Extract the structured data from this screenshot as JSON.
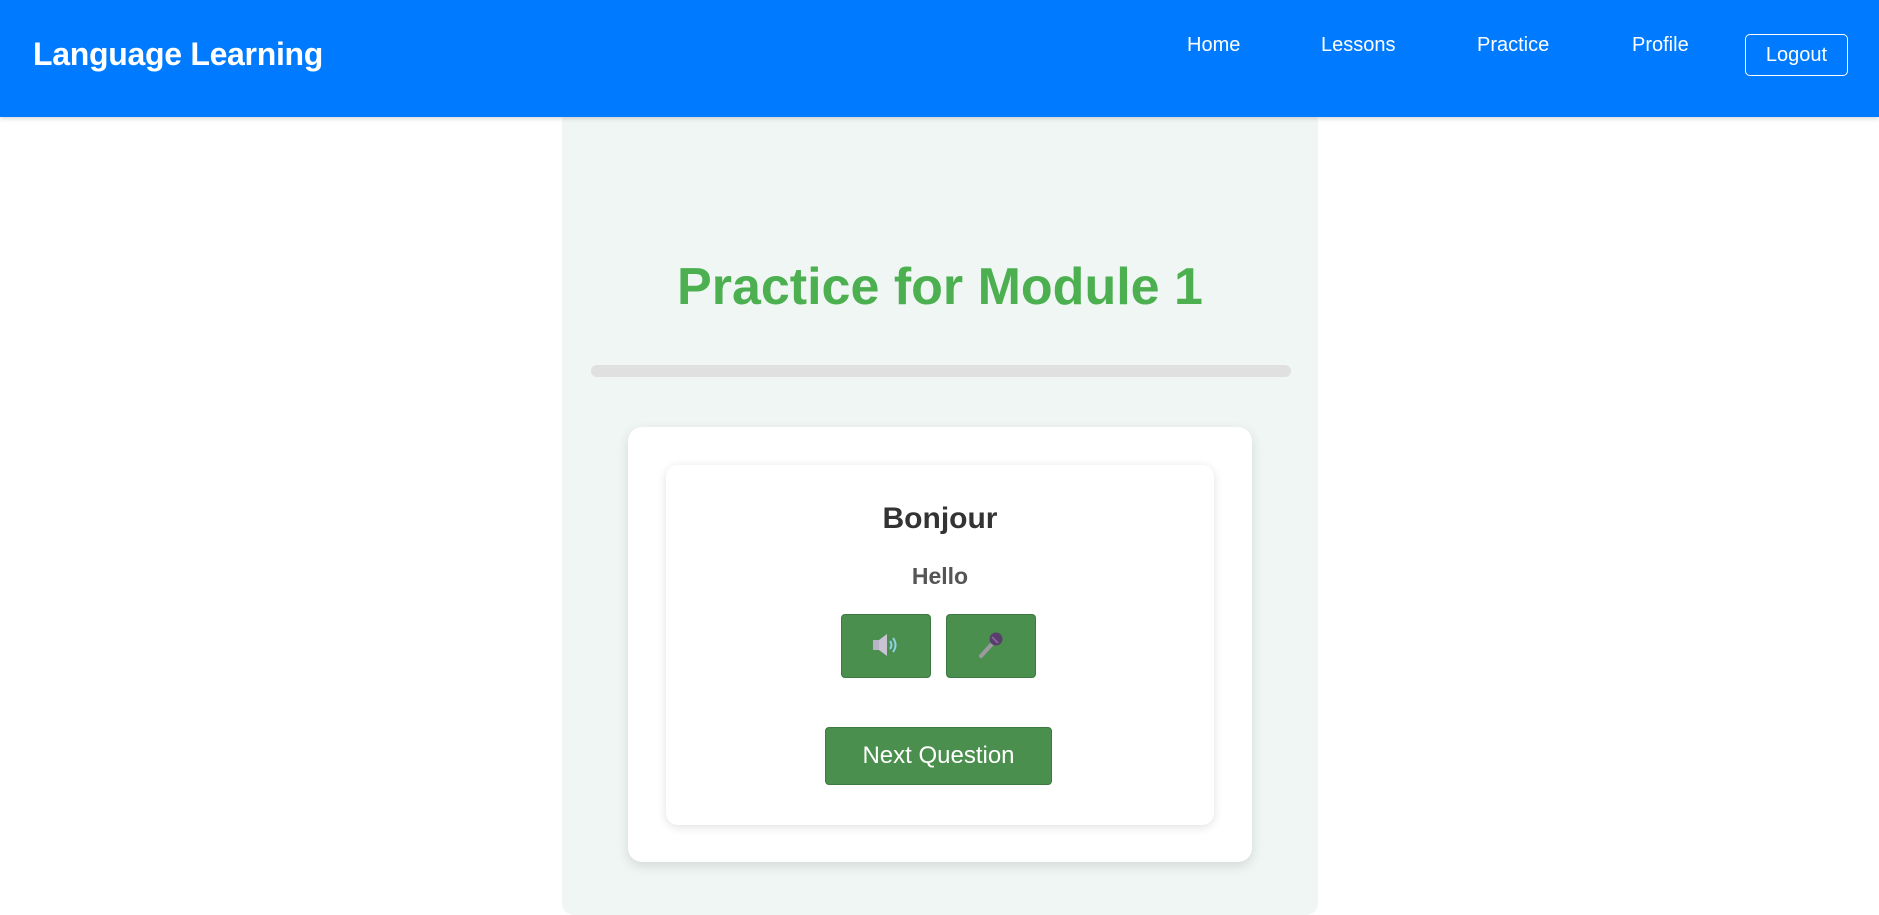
{
  "navbar": {
    "brand": "Language Learning",
    "links": [
      "Home",
      "Lessons",
      "Practice",
      "Profile"
    ],
    "logout_label": "Logout",
    "background_color": "#007bff"
  },
  "practice": {
    "title": "Practice for Module 1",
    "title_color": "#4caf50",
    "progress_fraction": 0,
    "card": {
      "word": "Bonjour",
      "translation": "Hello",
      "speak_icon": "speaker-icon",
      "record_icon": "microphone-icon",
      "next_label": "Next Question",
      "button_color": "#4a8f4d"
    }
  }
}
